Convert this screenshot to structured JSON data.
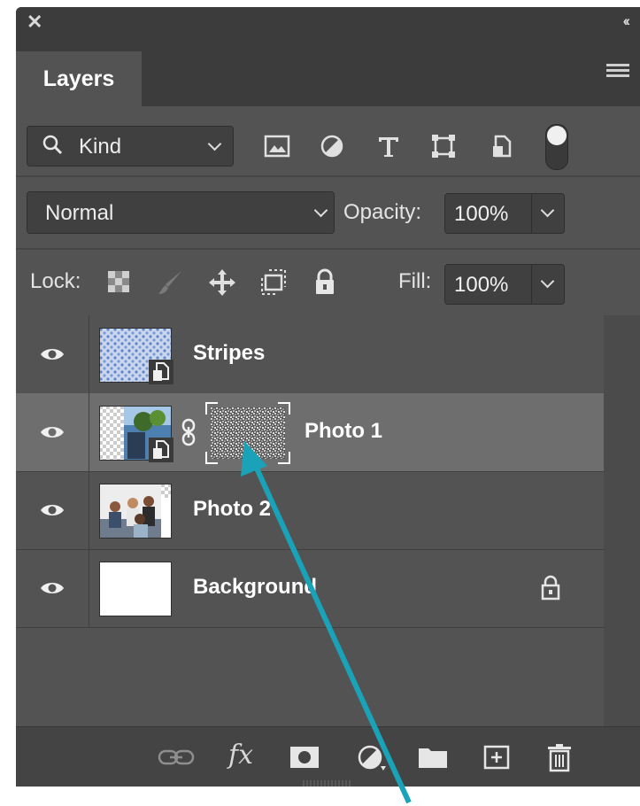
{
  "window": {
    "close_glyph": "✕",
    "collapse_glyph": "‹‹"
  },
  "panel": {
    "tab_label": "Layers",
    "menu_icon": "panel-menu-icon"
  },
  "filter": {
    "kind_label": "Kind",
    "buttons": [
      "pixel-layer-filter-icon",
      "adjustment-layer-filter-icon",
      "type-layer-filter-icon",
      "shape-layer-filter-icon",
      "smart-object-filter-icon"
    ]
  },
  "blend": {
    "mode": "Normal",
    "opacity_label": "Opacity:",
    "opacity_value": "100%"
  },
  "lock": {
    "label": "Lock:",
    "fill_label": "Fill:",
    "fill_value": "100%"
  },
  "layers": [
    {
      "name": "Stripes",
      "selected": false,
      "has_mask": false,
      "smart_object": true,
      "locked": false
    },
    {
      "name": "Photo 1",
      "selected": true,
      "has_mask": true,
      "smart_object": true,
      "locked": false
    },
    {
      "name": "Photo 2",
      "selected": false,
      "has_mask": false,
      "smart_object": false,
      "locked": false
    },
    {
      "name": "Background",
      "selected": false,
      "has_mask": false,
      "smart_object": false,
      "locked": true
    }
  ],
  "bottom_bar": {
    "buttons": [
      "link-layers-icon",
      "fx-icon",
      "add-mask-icon",
      "adjustment-layer-icon",
      "new-group-icon",
      "new-layer-icon",
      "delete-layer-icon"
    ],
    "fx_label": "fx"
  },
  "colors": {
    "panel_bg": "#535353",
    "selected_row": "#6e6e6e",
    "annotation_arrow": "#1aa2b8"
  }
}
